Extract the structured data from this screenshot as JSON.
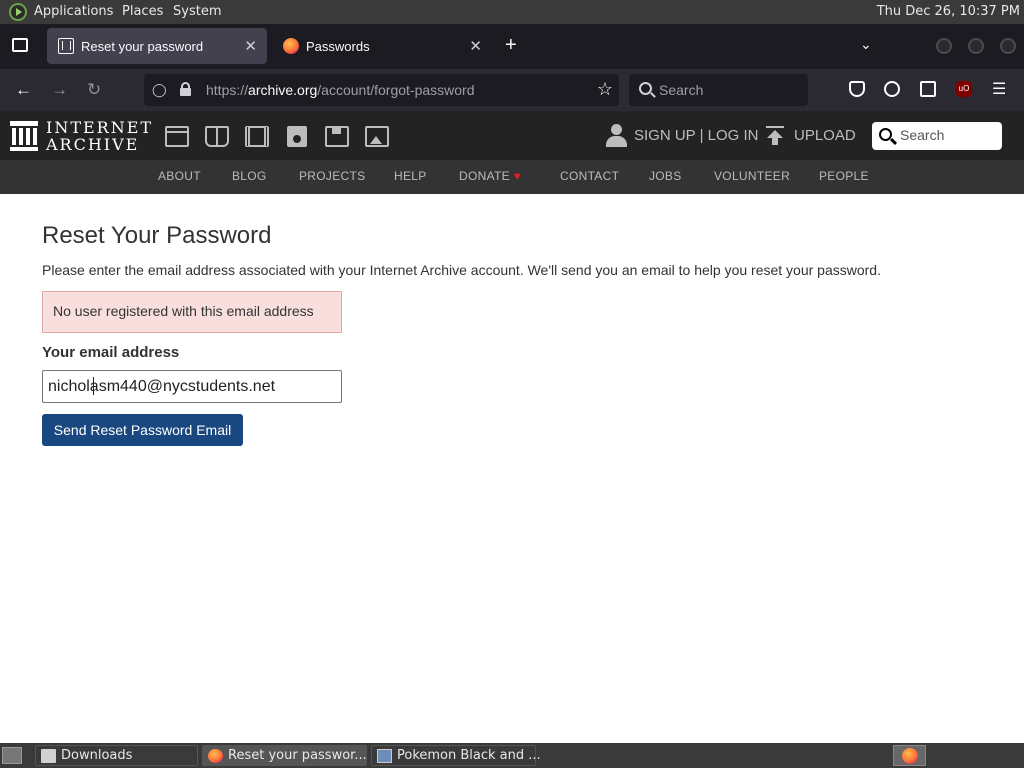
{
  "desktop": {
    "menus": [
      "Applications",
      "Places",
      "System"
    ],
    "clock": "Thu Dec 26, 10:37 PM"
  },
  "browser": {
    "tabs": [
      {
        "title": "Reset your password",
        "active": true,
        "icon": "internet-archive-icon"
      },
      {
        "title": "Passwords",
        "active": false,
        "icon": "firefox-icon"
      }
    ],
    "new_tab": "+",
    "tab_list": "⌄",
    "url_scheme": "https://",
    "url_domain": "archive.org",
    "url_path": "/account/forgot-password",
    "search_placeholder": "Search",
    "accent": "#1c1b22"
  },
  "ia": {
    "wordmark_line1": "INTERNET",
    "wordmark_line2": "ARCHIVE",
    "media_icons": [
      "web-icon",
      "texts-icon",
      "video-icon",
      "audio-icon",
      "software-icon",
      "images-icon"
    ],
    "sign_up": "SIGN UP | LOG IN",
    "upload": "UPLOAD",
    "search_placeholder": "Search",
    "nav": [
      "ABOUT",
      "BLOG",
      "PROJECTS",
      "HELP",
      "DONATE",
      "CONTACT",
      "JOBS",
      "VOLUNTEER",
      "PEOPLE"
    ],
    "donate_heart": "♥"
  },
  "page": {
    "title": "Reset Your Password",
    "instructions": "Please enter the email address associated with your Internet Archive account. We'll send you an email to help you reset your password.",
    "error": "No user registered with this email address",
    "email_label": "Your email address",
    "email_value": "nicholasm440@nycstudents.net",
    "submit_label": "Send Reset Password Email",
    "button_color": "#194880",
    "error_bg": "#f9dede"
  },
  "taskbar": {
    "tasks": [
      {
        "label": "Downloads",
        "active": false
      },
      {
        "label": "Reset your passwor...",
        "active": true
      },
      {
        "label": "Pokemon Black and ...",
        "active": false
      }
    ]
  }
}
